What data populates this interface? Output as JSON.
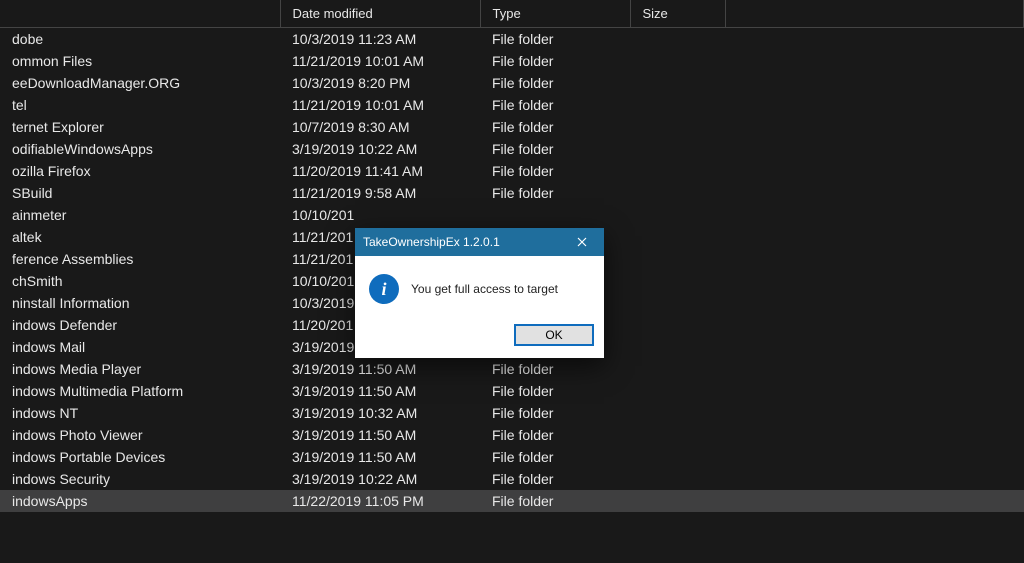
{
  "columns": {
    "name": "",
    "date": "Date modified",
    "type": "Type",
    "size": "Size"
  },
  "files": [
    {
      "name": "dobe",
      "date": "10/3/2019 11:23 AM",
      "type": "File folder",
      "size": ""
    },
    {
      "name": "ommon Files",
      "date": "11/21/2019 10:01 AM",
      "type": "File folder",
      "size": ""
    },
    {
      "name": "eeDownloadManager.ORG",
      "date": "10/3/2019 8:20 PM",
      "type": "File folder",
      "size": ""
    },
    {
      "name": "tel",
      "date": "11/21/2019 10:01 AM",
      "type": "File folder",
      "size": ""
    },
    {
      "name": "ternet Explorer",
      "date": "10/7/2019 8:30 AM",
      "type": "File folder",
      "size": ""
    },
    {
      "name": "odifiableWindowsApps",
      "date": "3/19/2019 10:22 AM",
      "type": "File folder",
      "size": ""
    },
    {
      "name": "ozilla Firefox",
      "date": "11/20/2019 11:41 AM",
      "type": "File folder",
      "size": ""
    },
    {
      "name": "SBuild",
      "date": "11/21/2019 9:58 AM",
      "type": "File folder",
      "size": ""
    },
    {
      "name": "ainmeter",
      "date": "10/10/201",
      "type": "",
      "size": ""
    },
    {
      "name": "altek",
      "date": "11/21/201",
      "type": "",
      "size": ""
    },
    {
      "name": "ference Assemblies",
      "date": "11/21/201",
      "type": "",
      "size": ""
    },
    {
      "name": "chSmith",
      "date": "10/10/201",
      "type": "",
      "size": ""
    },
    {
      "name": "ninstall Information",
      "date": "10/3/2019",
      "type": "",
      "size": ""
    },
    {
      "name": "indows Defender",
      "date": "11/20/201",
      "type": "",
      "size": ""
    },
    {
      "name": "indows Mail",
      "date": "3/19/2019",
      "type": "",
      "size": ""
    },
    {
      "name": "indows Media Player",
      "date": "3/19/2019 11:50 AM",
      "type": "File folder",
      "size": ""
    },
    {
      "name": "indows Multimedia Platform",
      "date": "3/19/2019 11:50 AM",
      "type": "File folder",
      "size": ""
    },
    {
      "name": "indows NT",
      "date": "3/19/2019 10:32 AM",
      "type": "File folder",
      "size": ""
    },
    {
      "name": "indows Photo Viewer",
      "date": "3/19/2019 11:50 AM",
      "type": "File folder",
      "size": ""
    },
    {
      "name": "indows Portable Devices",
      "date": "3/19/2019 11:50 AM",
      "type": "File folder",
      "size": ""
    },
    {
      "name": "indows Security",
      "date": "3/19/2019 10:22 AM",
      "type": "File folder",
      "size": ""
    },
    {
      "name": "indowsApps",
      "date": "11/22/2019 11:05 PM",
      "type": "File folder",
      "size": "",
      "selected": true
    },
    {
      "name": "",
      "date": "",
      "type": "",
      "size": ""
    }
  ],
  "dialog": {
    "title": "TakeOwnershipEx 1.2.0.1",
    "message": "You get full access to target",
    "ok": "OK"
  }
}
